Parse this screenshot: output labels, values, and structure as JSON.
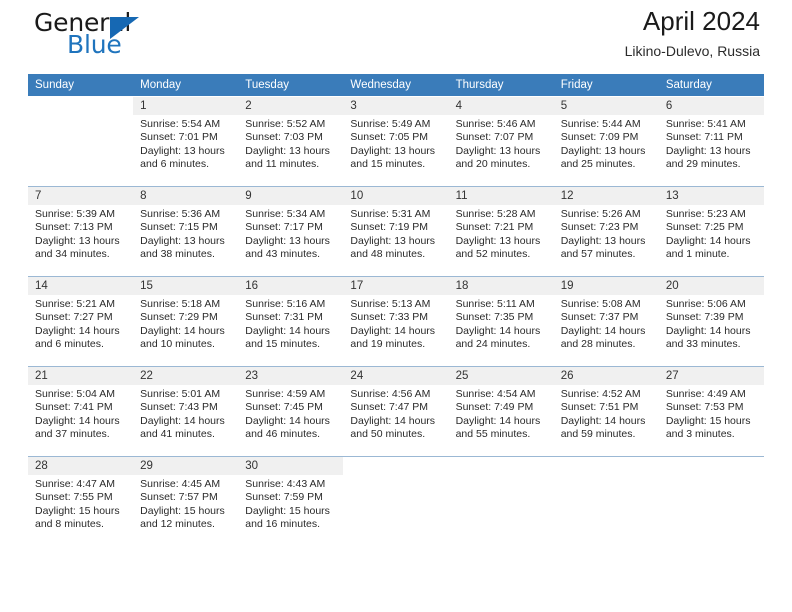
{
  "brand": {
    "name_part1": "General",
    "name_part2": "Blue",
    "logo_icon": "triangle-icon",
    "accent_color": "#1668b3"
  },
  "header": {
    "title": "April 2024",
    "location": "Likino-Dulevo, Russia",
    "header_bg": "#3a7cba",
    "daynum_bg": "#f0f0f0"
  },
  "calendar": {
    "weekday_headers": [
      "Sunday",
      "Monday",
      "Tuesday",
      "Wednesday",
      "Thursday",
      "Friday",
      "Saturday"
    ],
    "weeks": [
      [
        {
          "day": "",
          "sunrise": "",
          "sunset": "",
          "daylight_line1": "",
          "daylight_line2": ""
        },
        {
          "day": "1",
          "sunrise": "Sunrise: 5:54 AM",
          "sunset": "Sunset: 7:01 PM",
          "daylight_line1": "Daylight: 13 hours",
          "daylight_line2": "and 6 minutes."
        },
        {
          "day": "2",
          "sunrise": "Sunrise: 5:52 AM",
          "sunset": "Sunset: 7:03 PM",
          "daylight_line1": "Daylight: 13 hours",
          "daylight_line2": "and 11 minutes."
        },
        {
          "day": "3",
          "sunrise": "Sunrise: 5:49 AM",
          "sunset": "Sunset: 7:05 PM",
          "daylight_line1": "Daylight: 13 hours",
          "daylight_line2": "and 15 minutes."
        },
        {
          "day": "4",
          "sunrise": "Sunrise: 5:46 AM",
          "sunset": "Sunset: 7:07 PM",
          "daylight_line1": "Daylight: 13 hours",
          "daylight_line2": "and 20 minutes."
        },
        {
          "day": "5",
          "sunrise": "Sunrise: 5:44 AM",
          "sunset": "Sunset: 7:09 PM",
          "daylight_line1": "Daylight: 13 hours",
          "daylight_line2": "and 25 minutes."
        },
        {
          "day": "6",
          "sunrise": "Sunrise: 5:41 AM",
          "sunset": "Sunset: 7:11 PM",
          "daylight_line1": "Daylight: 13 hours",
          "daylight_line2": "and 29 minutes."
        }
      ],
      [
        {
          "day": "7",
          "sunrise": "Sunrise: 5:39 AM",
          "sunset": "Sunset: 7:13 PM",
          "daylight_line1": "Daylight: 13 hours",
          "daylight_line2": "and 34 minutes."
        },
        {
          "day": "8",
          "sunrise": "Sunrise: 5:36 AM",
          "sunset": "Sunset: 7:15 PM",
          "daylight_line1": "Daylight: 13 hours",
          "daylight_line2": "and 38 minutes."
        },
        {
          "day": "9",
          "sunrise": "Sunrise: 5:34 AM",
          "sunset": "Sunset: 7:17 PM",
          "daylight_line1": "Daylight: 13 hours",
          "daylight_line2": "and 43 minutes."
        },
        {
          "day": "10",
          "sunrise": "Sunrise: 5:31 AM",
          "sunset": "Sunset: 7:19 PM",
          "daylight_line1": "Daylight: 13 hours",
          "daylight_line2": "and 48 minutes."
        },
        {
          "day": "11",
          "sunrise": "Sunrise: 5:28 AM",
          "sunset": "Sunset: 7:21 PM",
          "daylight_line1": "Daylight: 13 hours",
          "daylight_line2": "and 52 minutes."
        },
        {
          "day": "12",
          "sunrise": "Sunrise: 5:26 AM",
          "sunset": "Sunset: 7:23 PM",
          "daylight_line1": "Daylight: 13 hours",
          "daylight_line2": "and 57 minutes."
        },
        {
          "day": "13",
          "sunrise": "Sunrise: 5:23 AM",
          "sunset": "Sunset: 7:25 PM",
          "daylight_line1": "Daylight: 14 hours",
          "daylight_line2": "and 1 minute."
        }
      ],
      [
        {
          "day": "14",
          "sunrise": "Sunrise: 5:21 AM",
          "sunset": "Sunset: 7:27 PM",
          "daylight_line1": "Daylight: 14 hours",
          "daylight_line2": "and 6 minutes."
        },
        {
          "day": "15",
          "sunrise": "Sunrise: 5:18 AM",
          "sunset": "Sunset: 7:29 PM",
          "daylight_line1": "Daylight: 14 hours",
          "daylight_line2": "and 10 minutes."
        },
        {
          "day": "16",
          "sunrise": "Sunrise: 5:16 AM",
          "sunset": "Sunset: 7:31 PM",
          "daylight_line1": "Daylight: 14 hours",
          "daylight_line2": "and 15 minutes."
        },
        {
          "day": "17",
          "sunrise": "Sunrise: 5:13 AM",
          "sunset": "Sunset: 7:33 PM",
          "daylight_line1": "Daylight: 14 hours",
          "daylight_line2": "and 19 minutes."
        },
        {
          "day": "18",
          "sunrise": "Sunrise: 5:11 AM",
          "sunset": "Sunset: 7:35 PM",
          "daylight_line1": "Daylight: 14 hours",
          "daylight_line2": "and 24 minutes."
        },
        {
          "day": "19",
          "sunrise": "Sunrise: 5:08 AM",
          "sunset": "Sunset: 7:37 PM",
          "daylight_line1": "Daylight: 14 hours",
          "daylight_line2": "and 28 minutes."
        },
        {
          "day": "20",
          "sunrise": "Sunrise: 5:06 AM",
          "sunset": "Sunset: 7:39 PM",
          "daylight_line1": "Daylight: 14 hours",
          "daylight_line2": "and 33 minutes."
        }
      ],
      [
        {
          "day": "21",
          "sunrise": "Sunrise: 5:04 AM",
          "sunset": "Sunset: 7:41 PM",
          "daylight_line1": "Daylight: 14 hours",
          "daylight_line2": "and 37 minutes."
        },
        {
          "day": "22",
          "sunrise": "Sunrise: 5:01 AM",
          "sunset": "Sunset: 7:43 PM",
          "daylight_line1": "Daylight: 14 hours",
          "daylight_line2": "and 41 minutes."
        },
        {
          "day": "23",
          "sunrise": "Sunrise: 4:59 AM",
          "sunset": "Sunset: 7:45 PM",
          "daylight_line1": "Daylight: 14 hours",
          "daylight_line2": "and 46 minutes."
        },
        {
          "day": "24",
          "sunrise": "Sunrise: 4:56 AM",
          "sunset": "Sunset: 7:47 PM",
          "daylight_line1": "Daylight: 14 hours",
          "daylight_line2": "and 50 minutes."
        },
        {
          "day": "25",
          "sunrise": "Sunrise: 4:54 AM",
          "sunset": "Sunset: 7:49 PM",
          "daylight_line1": "Daylight: 14 hours",
          "daylight_line2": "and 55 minutes."
        },
        {
          "day": "26",
          "sunrise": "Sunrise: 4:52 AM",
          "sunset": "Sunset: 7:51 PM",
          "daylight_line1": "Daylight: 14 hours",
          "daylight_line2": "and 59 minutes."
        },
        {
          "day": "27",
          "sunrise": "Sunrise: 4:49 AM",
          "sunset": "Sunset: 7:53 PM",
          "daylight_line1": "Daylight: 15 hours",
          "daylight_line2": "and 3 minutes."
        }
      ],
      [
        {
          "day": "28",
          "sunrise": "Sunrise: 4:47 AM",
          "sunset": "Sunset: 7:55 PM",
          "daylight_line1": "Daylight: 15 hours",
          "daylight_line2": "and 8 minutes."
        },
        {
          "day": "29",
          "sunrise": "Sunrise: 4:45 AM",
          "sunset": "Sunset: 7:57 PM",
          "daylight_line1": "Daylight: 15 hours",
          "daylight_line2": "and 12 minutes."
        },
        {
          "day": "30",
          "sunrise": "Sunrise: 4:43 AM",
          "sunset": "Sunset: 7:59 PM",
          "daylight_line1": "Daylight: 15 hours",
          "daylight_line2": "and 16 minutes."
        },
        {
          "day": "",
          "sunrise": "",
          "sunset": "",
          "daylight_line1": "",
          "daylight_line2": ""
        },
        {
          "day": "",
          "sunrise": "",
          "sunset": "",
          "daylight_line1": "",
          "daylight_line2": ""
        },
        {
          "day": "",
          "sunrise": "",
          "sunset": "",
          "daylight_line1": "",
          "daylight_line2": ""
        },
        {
          "day": "",
          "sunrise": "",
          "sunset": "",
          "daylight_line1": "",
          "daylight_line2": ""
        }
      ]
    ]
  }
}
